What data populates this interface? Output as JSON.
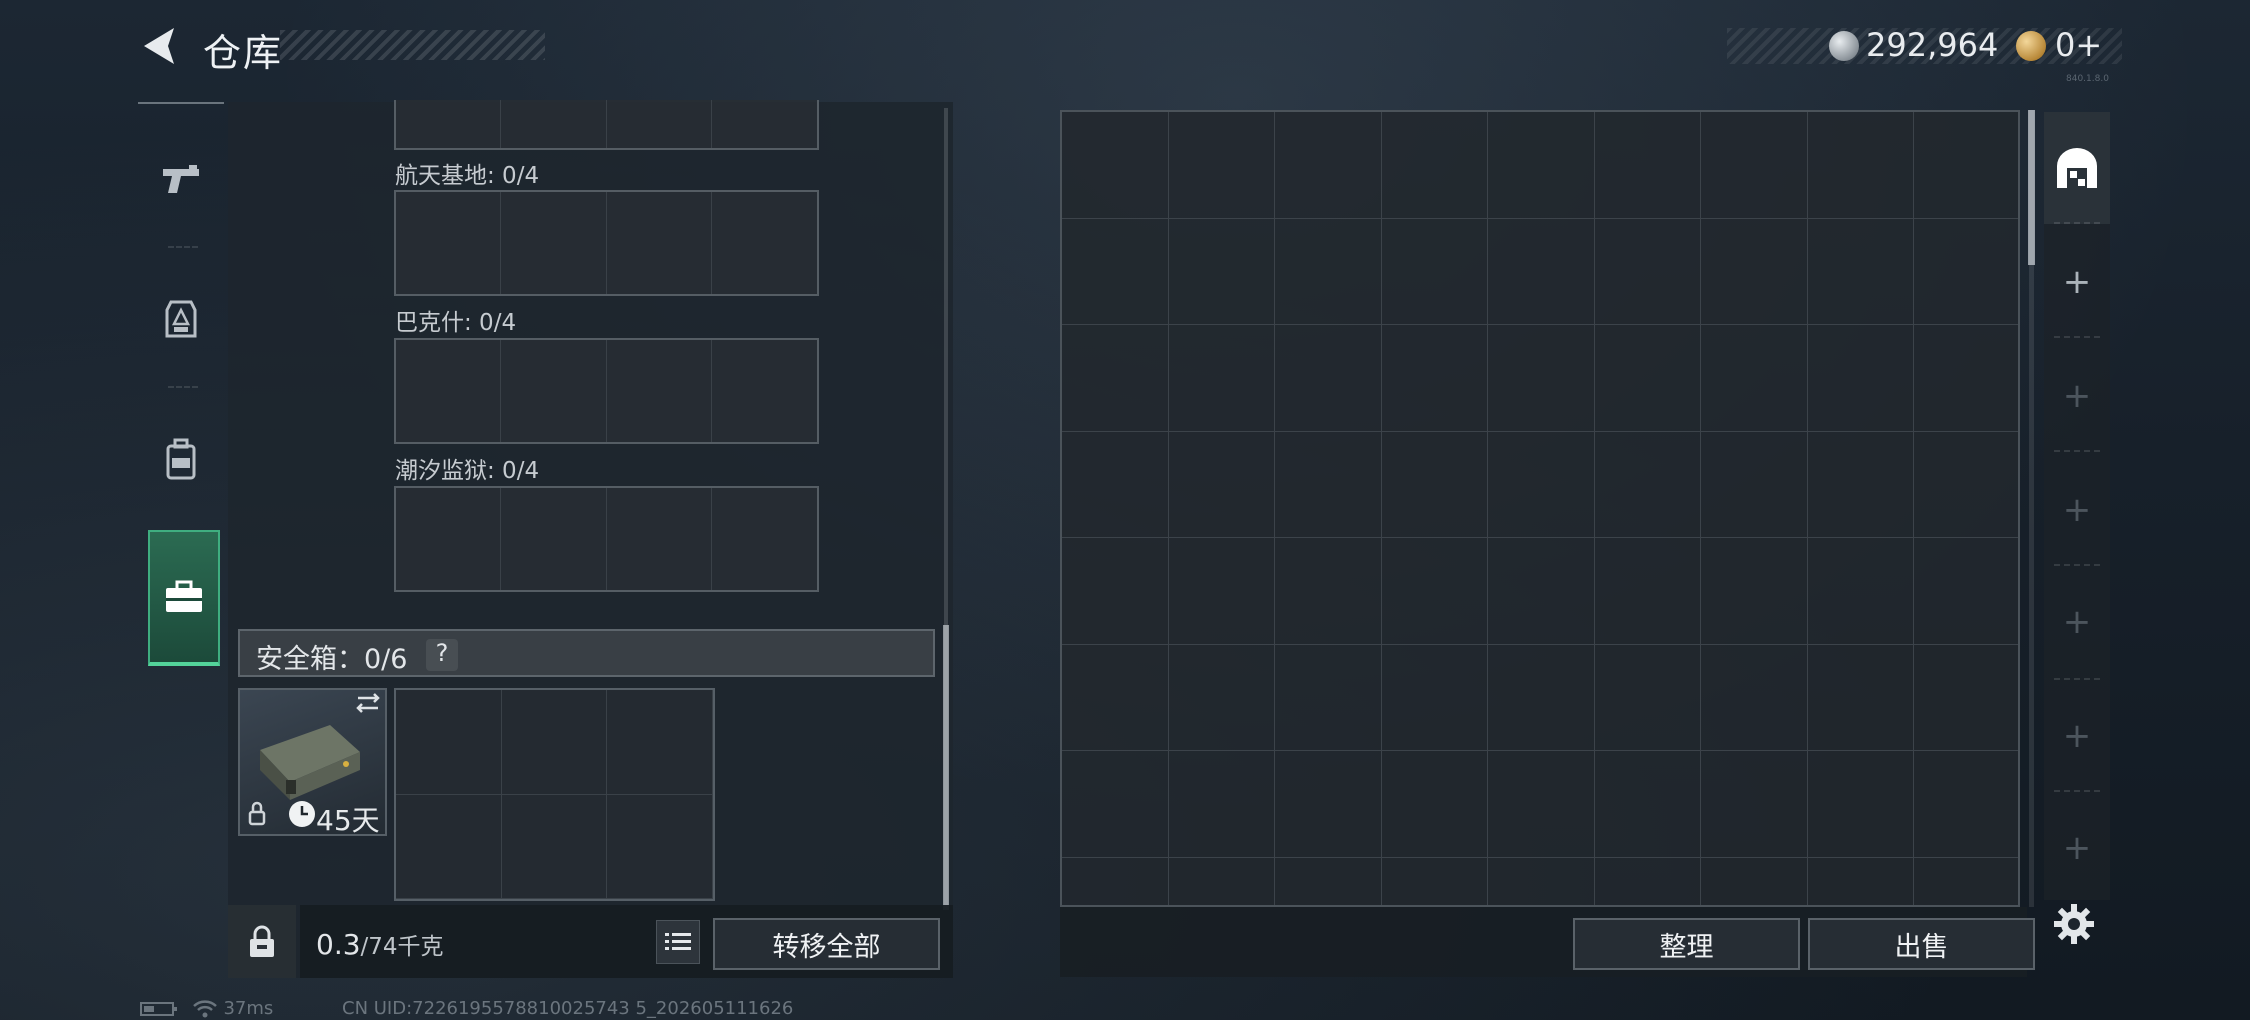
{
  "header": {
    "title": "仓库",
    "money": "292,964",
    "coupons": "0+",
    "version": "840.1.8.0"
  },
  "tabs": [
    {
      "name": "weapons",
      "icon": "pistol-icon"
    },
    {
      "name": "gear",
      "icon": "armor-icon"
    },
    {
      "name": "backpack",
      "icon": "backpack-icon"
    },
    {
      "name": "containers",
      "icon": "briefcase-icon",
      "active": true
    }
  ],
  "keys_sections": [
    {
      "label": "航天基地: 0/4"
    },
    {
      "label": "巴克什: 0/4"
    },
    {
      "label": "潮汐监狱: 0/4"
    }
  ],
  "safe_box": {
    "label": "安全箱：0/6",
    "help": "?",
    "duration": "45天"
  },
  "footer_left": {
    "weight": "0.3",
    "weight_unit": "/74千克",
    "transfer_all": "转移全部"
  },
  "footer_right": {
    "sort": "整理",
    "sell": "出售"
  },
  "right_tabs": [
    "warehouse-icon",
    "+",
    "+",
    "+",
    "+",
    "+",
    "+"
  ],
  "status_bar": {
    "ping": "37ms",
    "uid": "CN UID:7226195578810025743 5_202605111626"
  },
  "colors": {
    "accent_green": "#3fae80",
    "panel_bg": "#1e262e"
  }
}
